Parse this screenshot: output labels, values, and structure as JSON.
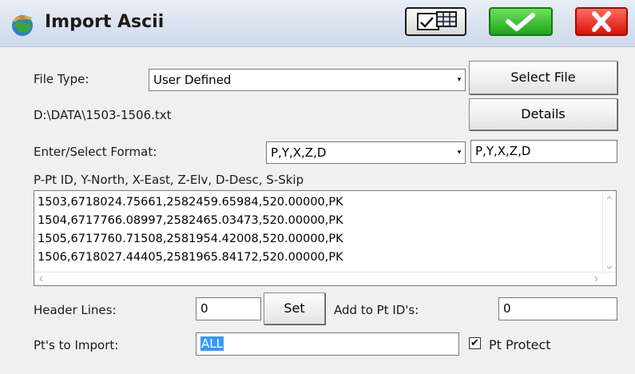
{
  "window": {
    "title": "Import Ascii"
  },
  "file_type": {
    "label": "File Type:",
    "value": "User Defined"
  },
  "select_file_button": "Select File",
  "file_path": "D:\\DATA\\1503-1506.txt",
  "details_button": "Details",
  "format": {
    "label": "Enter/Select Format:",
    "select_value": "P,Y,X,Z,D",
    "input_value": "P,Y,X,Z,D"
  },
  "legend": "P-Pt ID, Y-North, X-East, Z-Elv, D-Desc, S-Skip",
  "preview_lines": [
    "1503,6718024.75661,2582459.65984,520.00000,PK",
    "1504,6717766.08997,2582465.03473,520.00000,PK",
    "1505,6717760.71508,2581954.42008,520.00000,PK",
    "1506,6718027.44405,2581965.84172,520.00000,PK"
  ],
  "header_lines": {
    "label": "Header Lines:",
    "value": "0",
    "set_button": "Set"
  },
  "add_to_pt_ids": {
    "label": "Add to Pt ID's:",
    "value": "0"
  },
  "pts_to_import": {
    "label": "Pt's to Import:",
    "value": "ALL"
  },
  "pt_protect": {
    "label": "Pt Protect",
    "checked": true,
    "check_glyph": "✔"
  },
  "icons": [
    "app-logo-icon",
    "table-view-icon",
    "checkmark-icon",
    "close-icon"
  ],
  "colors": {
    "ok": "#21a31c",
    "cancel": "#d8120a",
    "selection": "#3399ff"
  }
}
